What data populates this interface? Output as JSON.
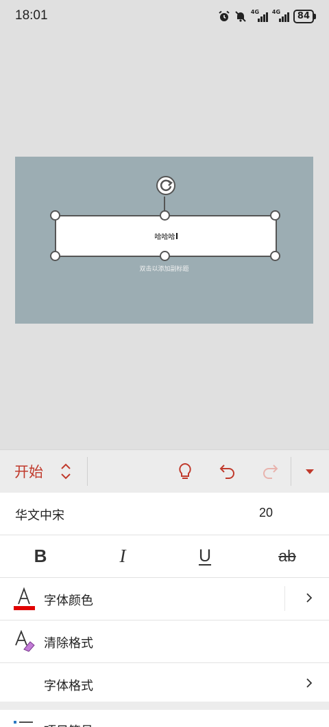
{
  "status_bar": {
    "time": "18:01",
    "icons": [
      "alarm-icon",
      "mute-icon"
    ],
    "network_label_1": "4G",
    "network_label_2": "4G",
    "battery": "84"
  },
  "slide": {
    "textbox_text": "哈哈哈",
    "subtitle_placeholder": "双击以添加副标题",
    "background_color": "#9cadb3"
  },
  "toolbar": {
    "tab_label": "开始",
    "accent_color": "#c0392b",
    "icons": [
      "lightbulb-icon",
      "undo-icon",
      "redo-icon",
      "dropdown-icon"
    ]
  },
  "font_panel": {
    "font_name": "华文中宋",
    "font_size": "20",
    "bold_label": "B",
    "italic_label": "I",
    "underline_label": "U",
    "strike_label": "ab",
    "font_color_label": "字体颜色",
    "font_color_value": "#e00000",
    "clear_format_label": "清除格式",
    "font_format_label": "字体格式",
    "bullets_label": "项目符号"
  }
}
